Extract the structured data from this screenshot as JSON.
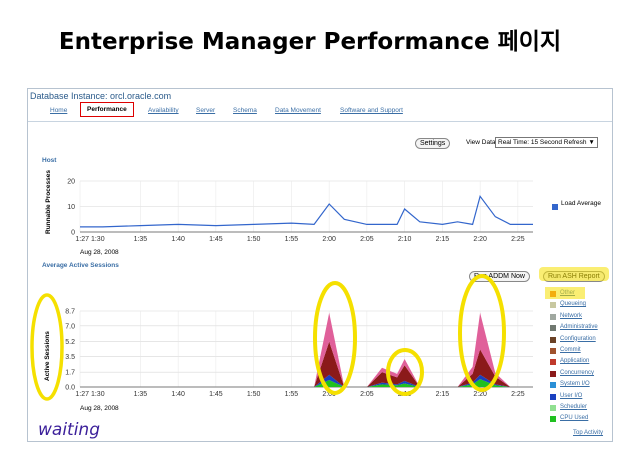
{
  "slide_title": "Enterprise Manager Performance 페이지",
  "window_title": "Database Instance: orcl.oracle.com",
  "tabs": [
    {
      "label": "Home",
      "active": false
    },
    {
      "label": "Performance",
      "active": true
    },
    {
      "label": "Availability",
      "active": false
    },
    {
      "label": "Server",
      "active": false
    },
    {
      "label": "Schema",
      "active": false
    },
    {
      "label": "Data Movement",
      "active": false
    },
    {
      "label": "Software and Support",
      "active": false
    }
  ],
  "toolbar": {
    "settings_label": "Settings",
    "view_data_label": "View Data",
    "view_data_value": "Real Time: 15 Second Refresh"
  },
  "host": {
    "section_title": "Host",
    "ylabel": "Runnable Processes",
    "legend_label": "Load Average",
    "legend_color": "#3366cc",
    "yticks": [
      "20",
      "10",
      "0"
    ],
    "xticks": [
      "1:27 1:30",
      "1:35",
      "1:40",
      "1:45",
      "1:50",
      "1:55",
      "2:00",
      "2:05",
      "2:10",
      "2:15",
      "2:20",
      "2:25"
    ],
    "date_label": "Aug 28, 2008"
  },
  "sessions": {
    "section_title": "Average Active Sessions",
    "run_addm_label": "Run ADDM Now",
    "run_ash_label": "Run ASH Report",
    "ylabel": "Active Sessions",
    "yticks": [
      "8.7",
      "7.0",
      "5.2",
      "3.5",
      "1.7",
      "0.0"
    ],
    "xticks": [
      "1:27 1:30",
      "1:35",
      "1:40",
      "1:45",
      "1:50",
      "1:55",
      "2:00",
      "2:05",
      "2:10",
      "2:15",
      "2:20",
      "2:25"
    ],
    "date_label": "Aug 28, 2008",
    "legend": [
      {
        "label": "Other",
        "color": "#f07020"
      },
      {
        "label": "Queueing",
        "color": "#c8c8a0"
      },
      {
        "label": "Network",
        "color": "#a0a8a0"
      },
      {
        "label": "Administrative",
        "color": "#707870"
      },
      {
        "label": "Configuration",
        "color": "#6b4226"
      },
      {
        "label": "Commit",
        "color": "#a0522d"
      },
      {
        "label": "Application",
        "color": "#c0392b"
      },
      {
        "label": "Concurrency",
        "color": "#8b1a1a"
      },
      {
        "label": "System I/O",
        "color": "#2b8fd6"
      },
      {
        "label": "User I/O",
        "color": "#1a40c0"
      },
      {
        "label": "Scheduler",
        "color": "#90e090"
      },
      {
        "label": "CPU Used",
        "color": "#20c020"
      }
    ],
    "top_activity_label": "Top Activity"
  },
  "annotation": {
    "handwriting": "waiting"
  },
  "chart_data": [
    {
      "type": "line",
      "title": "Host",
      "ylabel": "Runnable Processes",
      "ylim": [
        0,
        20
      ],
      "series": [
        {
          "name": "Load Average",
          "x": [
            "1:27",
            "1:30",
            "1:35",
            "1:40",
            "1:45",
            "1:50",
            "1:55",
            "1:58",
            "2:00",
            "2:02",
            "2:05",
            "2:07",
            "2:09",
            "2:10",
            "2:12",
            "2:15",
            "2:17",
            "2:19",
            "2:20",
            "2:22",
            "2:24",
            "2:27"
          ],
          "values": [
            2,
            2,
            2.5,
            3,
            2.5,
            3,
            3.5,
            3,
            11,
            5,
            3,
            3,
            3,
            9,
            4,
            3,
            4,
            3,
            14,
            6,
            3,
            3
          ]
        }
      ]
    },
    {
      "type": "area",
      "title": "Average Active Sessions",
      "ylabel": "Active Sessions",
      "ylim": [
        0,
        8.7
      ],
      "x": [
        "1:58",
        "2:00",
        "2:02",
        "2:05",
        "2:07",
        "2:09",
        "2:10",
        "2:12",
        "2:17",
        "2:19",
        "2:20",
        "2:22",
        "2:24"
      ],
      "series": [
        {
          "name": "CPU Used",
          "values": [
            0,
            0.8,
            0,
            0,
            0.3,
            0.2,
            0.4,
            0,
            0,
            0.3,
            0.9,
            0.2,
            0
          ]
        },
        {
          "name": "User I/O",
          "values": [
            0,
            0.6,
            0,
            0,
            0.2,
            0.1,
            0.3,
            0,
            0,
            0.2,
            0.5,
            0.1,
            0
          ]
        },
        {
          "name": "Concurrency",
          "values": [
            0,
            3.8,
            0,
            0,
            1.2,
            0.8,
            1.8,
            0,
            0,
            1.0,
            2.9,
            0.9,
            0
          ]
        },
        {
          "name": "Other",
          "values": [
            0,
            3.3,
            0,
            0,
            0.5,
            0.4,
            0.7,
            0,
            0,
            0.8,
            4.2,
            0.4,
            0
          ]
        }
      ]
    }
  ]
}
